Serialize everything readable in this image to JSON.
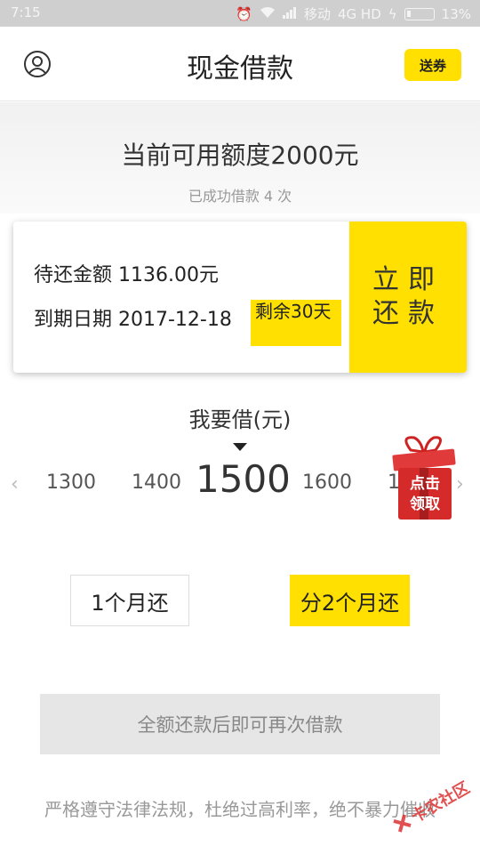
{
  "status_bar": {
    "time": "7:15",
    "carrier": "移动",
    "network": "4G HD",
    "battery": "13%",
    "battery_level": 0.13
  },
  "header": {
    "title": "现金借款",
    "coupon_label": "送券",
    "icon": "user-icon"
  },
  "quota": {
    "title": "当前可用额度2000元",
    "subtitle": "已成功借款 4 次"
  },
  "repay_card": {
    "amount_text": "待还金额 1136.00元",
    "due_text": "到期日期 2017-12-18",
    "remaining": "剩余30天",
    "button_label": "立即还款"
  },
  "borrow": {
    "label": "我要借(元)",
    "amounts": [
      "1300",
      "1400",
      "1500",
      "1600",
      "1700"
    ],
    "selected": "1500"
  },
  "gift": {
    "text_line1": "点击",
    "text_line2": "领取"
  },
  "terms": {
    "option1": "1个月还",
    "option2": "分2个月还",
    "selected": "分2个月还"
  },
  "action": {
    "disabled_label": "全额还款后即可再次借款"
  },
  "footer": {
    "note": "严格遵守法律法规，杜绝过高利率，绝不暴力催收"
  },
  "watermark": {
    "text": "卡农社区"
  },
  "colors": {
    "accent": "#ffe000",
    "status_bar": "#cfcfcf",
    "disabled": "#e6e6e6",
    "gift_red": "#d42a2a"
  }
}
